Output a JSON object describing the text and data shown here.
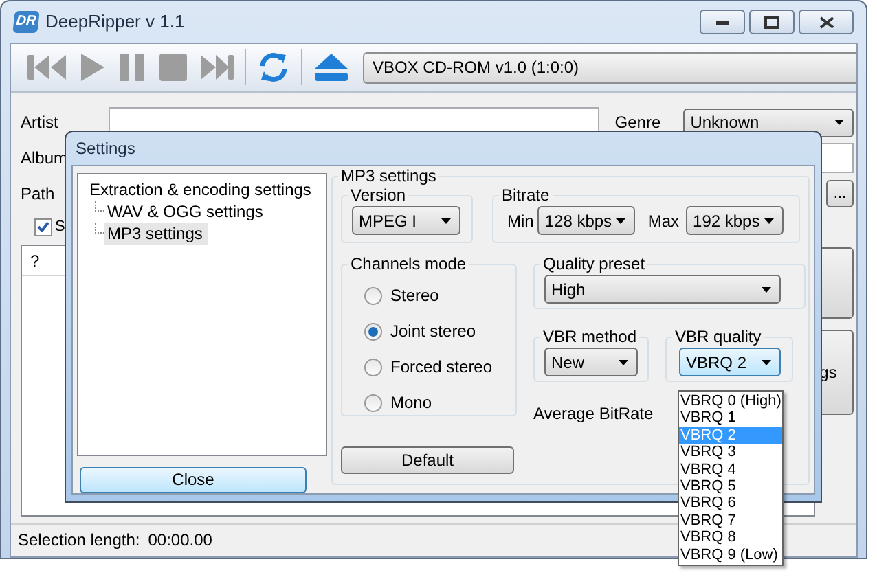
{
  "window": {
    "title": "DeepRipper v 1.1",
    "logo": "DR"
  },
  "toolbar": {
    "drive": "VBOX CD-ROM v1.0 (1:0:0)"
  },
  "form": {
    "artist_label": "Artist",
    "genre_label": "Genre",
    "genre": "Unknown",
    "album_label": "Album",
    "path_label": "Path",
    "browse": "...",
    "checkbox": {
      "label": "S",
      "checked": true
    }
  },
  "track_list": {
    "column_1": "?"
  },
  "side_button": {
    "label": "gs"
  },
  "status_bar": {
    "label": "Selection length:",
    "value": "00:00.00"
  },
  "dialog": {
    "title": "Settings",
    "tree": [
      {
        "label": "Extraction & encoding settings",
        "selected": false,
        "children": [
          {
            "label": "WAV & OGG settings",
            "selected": false
          },
          {
            "label": "MP3 settings",
            "selected": true
          }
        ]
      }
    ],
    "close": "Close",
    "mp3": {
      "title": "MP3 settings",
      "version": {
        "label": "Version",
        "value": "MPEG I"
      },
      "bitrate": {
        "label": "Bitrate",
        "min_label": "Min",
        "min": "128 kbps",
        "max_label": "Max",
        "max": "192 kbps"
      },
      "channels": {
        "label": "Channels mode",
        "options": [
          {
            "label": "Stereo",
            "selected": false
          },
          {
            "label": "Joint stereo",
            "selected": true
          },
          {
            "label": "Forced stereo",
            "selected": false
          },
          {
            "label": "Mono",
            "selected": false
          }
        ]
      },
      "quality_preset": {
        "label": "Quality preset",
        "value": "High"
      },
      "vbr_method": {
        "label": "VBR method",
        "value": "New"
      },
      "vbr_quality": {
        "label": "VBR quality",
        "value": "VBRQ 2",
        "expanded": true,
        "options": [
          {
            "label": "VBRQ 0 (High)",
            "selected": false
          },
          {
            "label": "VBRQ 1",
            "selected": false
          },
          {
            "label": "VBRQ 2",
            "selected": true
          },
          {
            "label": "VBRQ 3",
            "selected": false
          },
          {
            "label": "VBRQ 4",
            "selected": false
          },
          {
            "label": "VBRQ 5",
            "selected": false
          },
          {
            "label": "VBRQ 6",
            "selected": false
          },
          {
            "label": "VBRQ 7",
            "selected": false
          },
          {
            "label": "VBRQ 8",
            "selected": false
          },
          {
            "label": "VBRQ 9 (Low)",
            "selected": false
          }
        ]
      },
      "average_bitrate": "Average BitRate",
      "default": "Default"
    }
  }
}
